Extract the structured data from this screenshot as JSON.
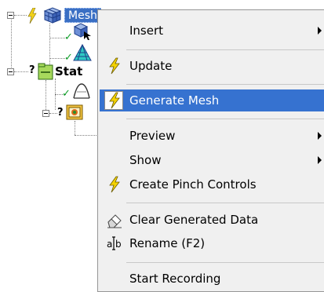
{
  "tree": {
    "mesh_label": "Mesh",
    "static_label": "Stat",
    "unknown_marker": "?"
  },
  "menu": {
    "items": [
      {
        "label": "Insert",
        "icon": "none",
        "submenu": true
      },
      {
        "label": "Update",
        "icon": "lightning-bolt-icon",
        "submenu": false
      },
      {
        "label": "Generate Mesh",
        "icon": "lightning-bolt-icon",
        "submenu": false,
        "selected": true
      },
      {
        "label": "Preview",
        "icon": "none",
        "submenu": true
      },
      {
        "label": "Show",
        "icon": "none",
        "submenu": true
      },
      {
        "label": "Create Pinch Controls",
        "icon": "lightning-bolt-icon",
        "submenu": false
      },
      {
        "label": "Clear Generated Data",
        "icon": "eraser-icon",
        "submenu": false
      },
      {
        "label": "Rename (F2)",
        "icon": "rename-icon",
        "submenu": false
      },
      {
        "label": "Start Recording",
        "icon": "none",
        "submenu": false
      }
    ],
    "colors": {
      "selection": "#3672d0",
      "background": "#f0f0f0"
    }
  }
}
